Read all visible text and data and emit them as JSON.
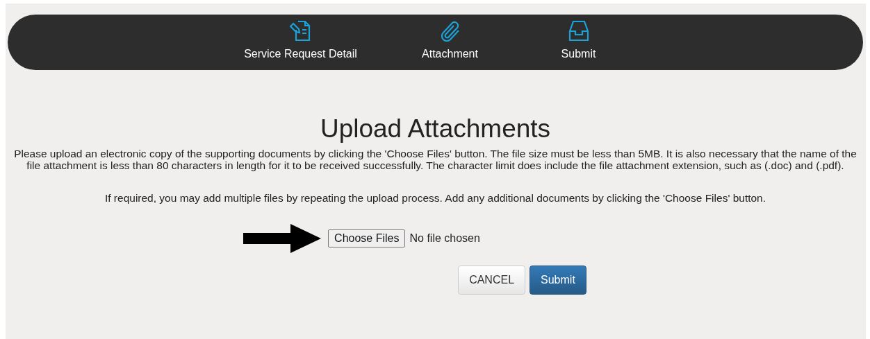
{
  "steps": [
    {
      "label": "Service Request Detail"
    },
    {
      "label": "Attachment"
    },
    {
      "label": "Submit"
    }
  ],
  "heading": "Upload Attachments",
  "paragraphs": [
    "Please upload an electronic copy of the supporting documents by clicking the 'Choose Files' button. The file size must be less than 5MB. It is also necessary that the name of the file attachment is less than 80 characters in length for it to be received successfully. The character limit does include the file attachment extension, such as (.doc) and (.pdf).",
    "If required, you may add multiple files by repeating the upload process. Add any additional documents by clicking the 'Choose Files' button."
  ],
  "file_input": {
    "button": "Choose Files",
    "status": "No file chosen"
  },
  "buttons": [
    {
      "label": "CANCEL",
      "kind": "default"
    },
    {
      "label": "Submit",
      "kind": "primary"
    }
  ]
}
